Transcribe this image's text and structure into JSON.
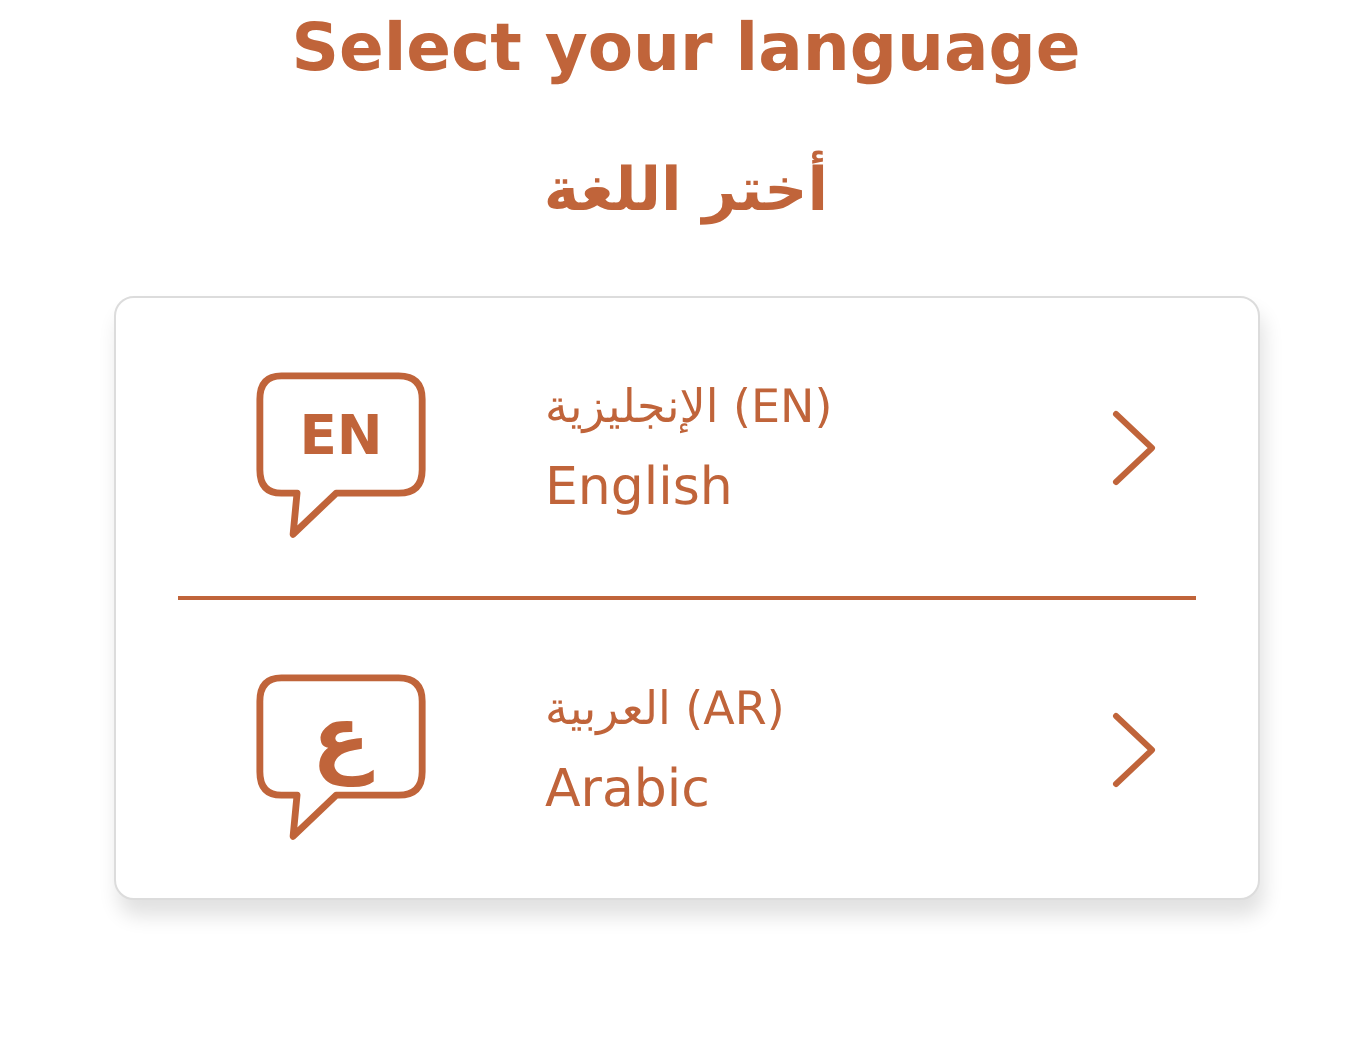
{
  "title": "Select your language",
  "subtitle": "أختر اللغة",
  "languages": [
    {
      "badge": "EN",
      "native": "الإنجليزية (EN)",
      "name": "English"
    },
    {
      "badge": "ع",
      "native": "العربية  (AR)",
      "name": "Arabic"
    }
  ]
}
